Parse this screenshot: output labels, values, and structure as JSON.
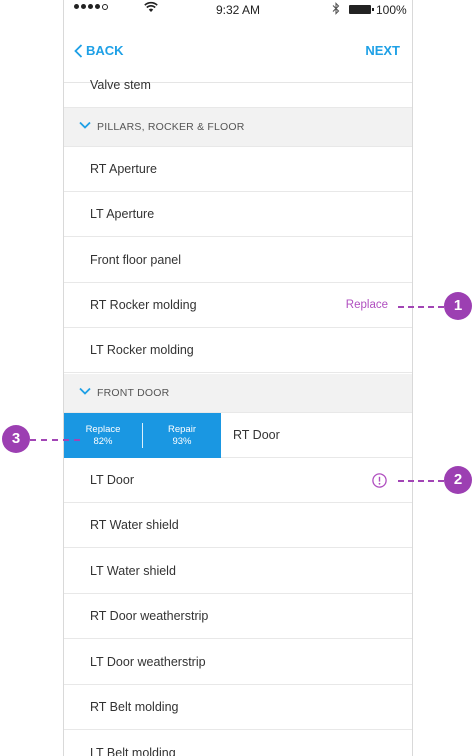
{
  "status_bar": {
    "time": "9:32 AM",
    "battery_percent": "100%"
  },
  "nav": {
    "back_label": "BACK",
    "next_label": "NEXT"
  },
  "list": {
    "items": [
      {
        "label": "Valve stem"
      },
      {
        "section": "PILLARS, ROCKER & FLOOR"
      },
      {
        "label": "RT Aperture"
      },
      {
        "label": "LT Aperture"
      },
      {
        "label": "Front floor panel"
      },
      {
        "label": "RT Rocker molding",
        "action": "Replace"
      },
      {
        "label": "LT Rocker molding"
      },
      {
        "section": "FRONT DOOR"
      },
      {
        "label": "RT Door",
        "swipe": {
          "replace_label": "Replace",
          "replace_pct": "82%",
          "repair_label": "Repair",
          "repair_pct": "93%"
        }
      },
      {
        "label": "LT Door",
        "alert": true
      },
      {
        "label": "RT Water shield"
      },
      {
        "label": "LT Water shield"
      },
      {
        "label": "RT Door weatherstrip"
      },
      {
        "label": "LT Door weatherstrip"
      },
      {
        "label": "RT Belt molding"
      },
      {
        "label": "LT Belt molding"
      }
    ]
  },
  "callouts": [
    "1",
    "2",
    "3"
  ],
  "colors": {
    "accent": "#1ea0e6",
    "swipe_bg": "#1a97e2",
    "callout": "#9c3fb2",
    "section_bg": "#f2f2f2"
  }
}
